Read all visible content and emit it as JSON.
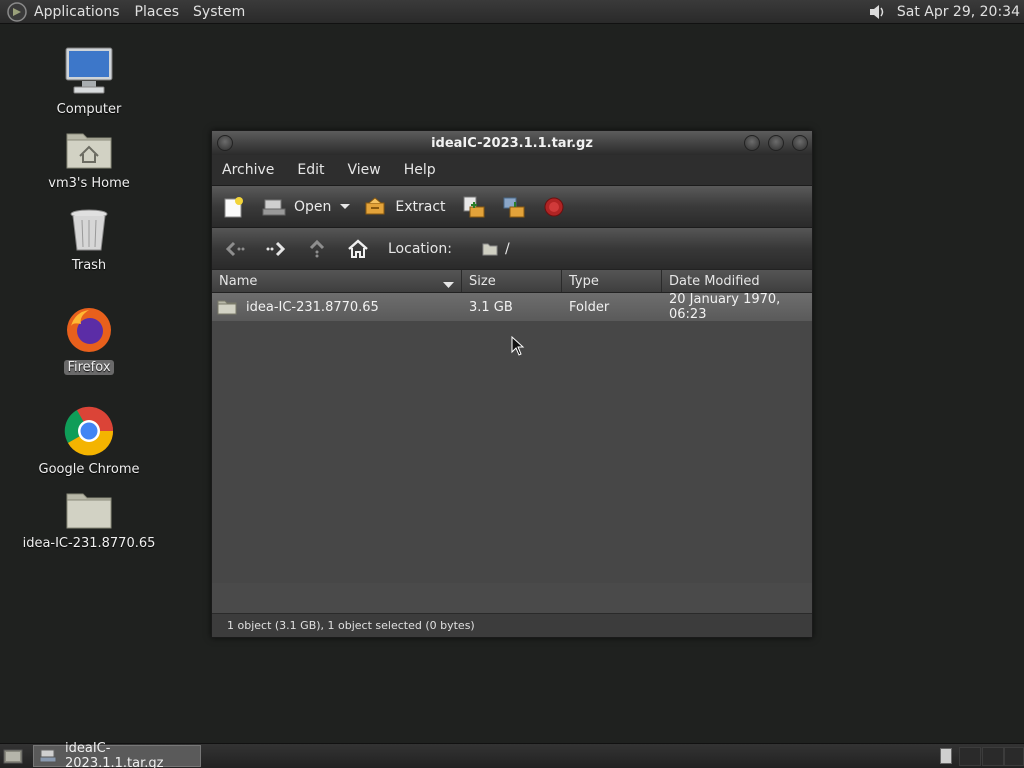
{
  "top_panel": {
    "menus": [
      "Applications",
      "Places",
      "System"
    ],
    "clock": "Sat Apr 29, 20:34"
  },
  "desktop": {
    "icons": [
      {
        "label": "Computer",
        "icon": "computer-icon"
      },
      {
        "label": "vm3's Home",
        "icon": "home-folder-icon"
      },
      {
        "label": "Trash",
        "icon": "trash-icon"
      },
      {
        "label": "Firefox",
        "icon": "firefox-icon"
      },
      {
        "label": "Google Chrome",
        "icon": "chrome-icon"
      },
      {
        "label": "idea-IC-231.8770.65",
        "icon": "folder-icon"
      }
    ]
  },
  "window": {
    "title": "ideaIC-2023.1.1.tar.gz",
    "menu": [
      "Archive",
      "Edit",
      "View",
      "Help"
    ],
    "toolbar": {
      "open_label": "Open",
      "extract_label": "Extract"
    },
    "location": {
      "label": "Location:",
      "path": "/"
    },
    "columns": [
      "Name",
      "Size",
      "Type",
      "Date Modified"
    ],
    "rows": [
      {
        "name": "idea-IC-231.8770.65",
        "size": "3.1 GB",
        "type": "Folder",
        "date": "20 January 1970, 06:23"
      }
    ],
    "status": "1 object (3.1 GB), 1 object selected (0 bytes)"
  },
  "taskbar": {
    "task_label": "ideaIC-2023.1.1.tar.gz"
  }
}
